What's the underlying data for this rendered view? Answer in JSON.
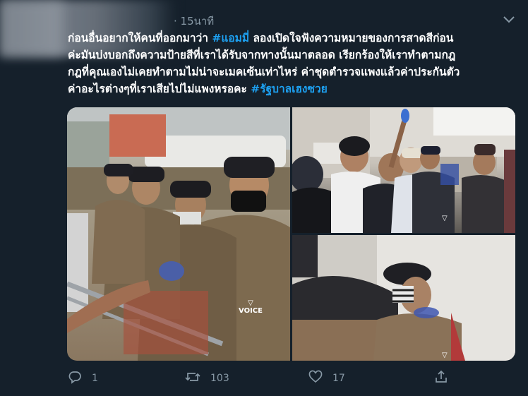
{
  "header": {
    "timestamp": "· 15นาที"
  },
  "tweet": {
    "lines": [
      [
        "ก่อนอื่นอยากให้คนที่ออกมาว่า ",
        "#แอมมี่",
        " ลองเปิดใจฟังความหมายของการสาดสีก่อน"
      ],
      [
        "ค่ะมันบ่งบอกถึงความป้ายสีที่เราได้รับจากทางนั้นมาตลอด เรียกร้องให้เราทำตามกฎ"
      ],
      [
        "กฎที่คุณเองไม่เคยทำตามไม่น่าจะเมคเซ้นเท่าไหร่ ค่าชุดตำรวจแพงแล้วค่าประกันตัว"
      ],
      [
        "ค่าอะไรต่างๆที่เราเสียไปไม่แพงหรอคะ ",
        "#รัฐบาลเฮงซวย"
      ]
    ]
  },
  "media": {
    "watermark": "VOICE",
    "watermark_sub": "online"
  },
  "actions": {
    "reply_count": "1",
    "retweet_count": "103",
    "like_count": "17"
  },
  "colors": {
    "background": "#15202b",
    "text": "#ffffff",
    "muted": "#8899a6",
    "hashtag": "#1da1f2"
  },
  "icons": [
    "chevron-down-icon",
    "reply-icon",
    "retweet-icon",
    "like-icon",
    "share-icon"
  ]
}
